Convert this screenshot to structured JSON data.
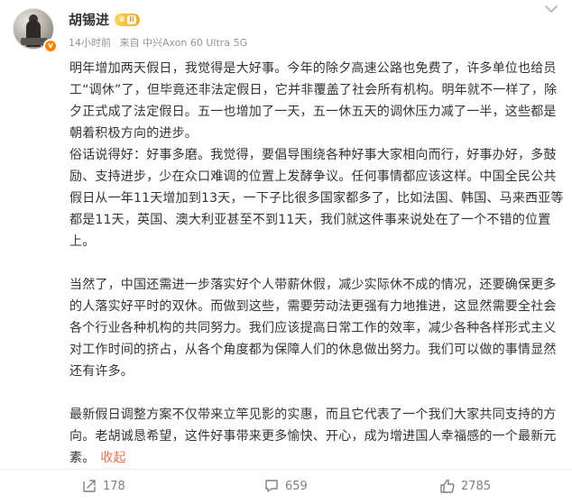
{
  "post": {
    "author": "胡锡进",
    "badge_level": "II",
    "time": "14小时前",
    "source": "来自 中兴Axon 60 Ultra 5G",
    "paragraphs": [
      "明年增加两天假日，我觉得是大好事。今年的除夕高速公路也免费了，许多单位也给员工“调休”了，但毕竟还非法定假日，它并非覆盖了社会所有机构。明年就不一样了，除夕正式成了法定假日。五一也增加了一天，五一休五天的调休压力减了一半，这些都是朝着积极方向的进步。",
      "俗话说得好：好事多磨。我觉得，要倡导围绕各种好事大家相向而行，好事办好，多鼓励、支持进步，少在众口难调的位置上发酵争议。任何事情都应该这样。中国全民公共假日从一年11天增加到13天，一下子比很多国家都多了，比如法国、韩国、马来西亚等都是11天，英国、澳大利亚甚至不到11天，我们就这件事来说处在了一个不错的位置上。",
      "当然了，中国还需进一步落实好个人带薪休假，减少实际休不成的情况，还要确保更多的人落实好平时的双休。而做到这些，需要劳动法更强有力地推进，这显然需要全社会各个行业各种机构的共同努力。我们应该提高日常工作的效率，减少各种各样形式主义对工作时间的挤占，从各个角度都为保障人们的休息做出努力。我们可以做的事情显然还有许多。",
      "最新假日调整方案不仅带来立竿见影的实惠，而且它代表了一个我们大家共同支持的方向。老胡诚恳希望，这件好事带来更多愉快、开心，成为增进国人幸福感的一个最新元素。"
    ],
    "collapse_label": "收起"
  },
  "actions": {
    "share_count": "178",
    "comment_count": "659",
    "like_count": "2785"
  },
  "colors": {
    "accent": "#eb7350",
    "verified": "#ff8200",
    "badge": "#f4a923",
    "meta": "#939393"
  },
  "icons": {
    "more": "chevron-down-icon",
    "share": "share-icon",
    "comment": "comment-icon",
    "like": "thumbs-up-icon",
    "verified": "verified-badge-icon"
  }
}
